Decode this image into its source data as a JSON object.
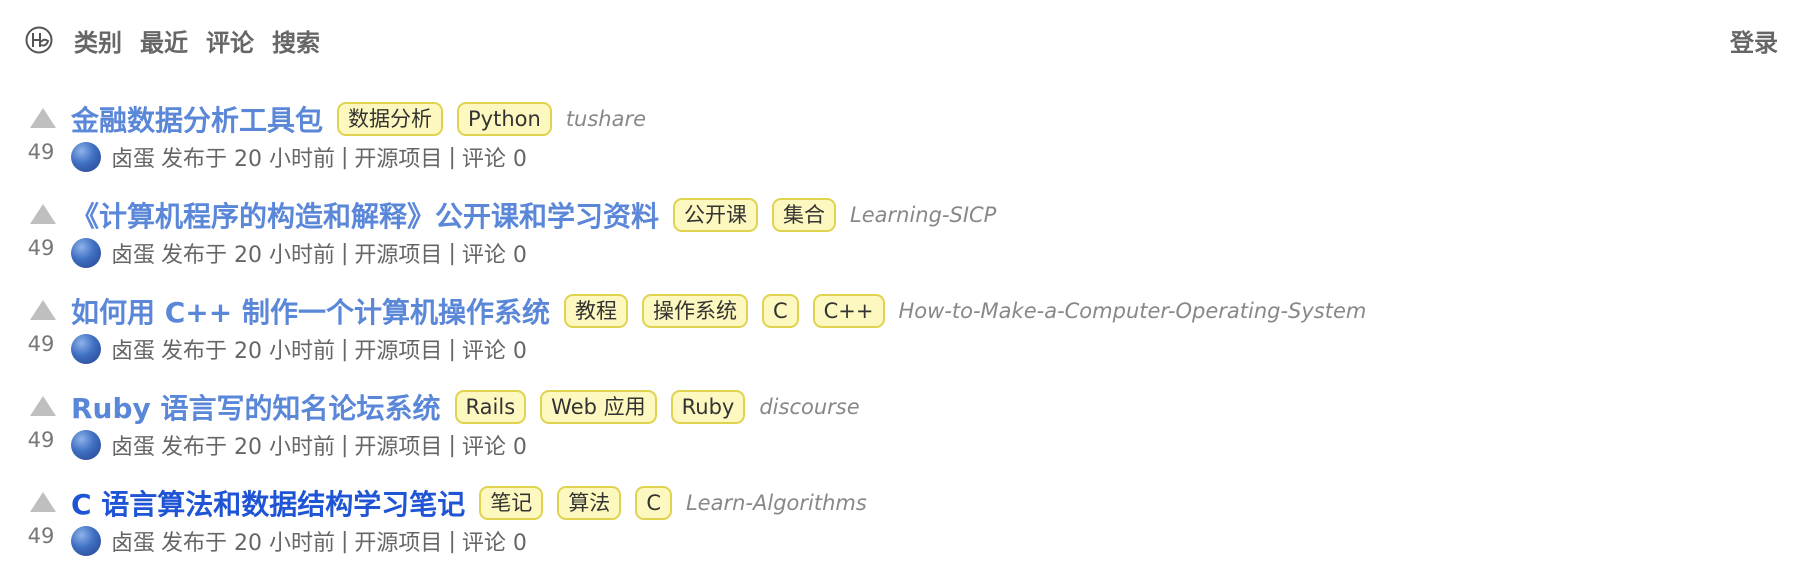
{
  "header": {
    "logo_icon": "logo-icon",
    "nav": [
      "类别",
      "最近",
      "评论",
      "搜索"
    ],
    "login": "登录"
  },
  "items": [
    {
      "votes": "49",
      "title": "金融数据分析工具包",
      "tags": [
        "数据分析",
        "Python"
      ],
      "repo": "tushare",
      "author": "卤蛋",
      "posted": "发布于 20 小时前",
      "category": "开源项目",
      "comments": "评论 0",
      "visited": false
    },
    {
      "votes": "49",
      "title": "《计算机程序的构造和解释》公开课和学习资料",
      "tags": [
        "公开课",
        "集合"
      ],
      "repo": "Learning-SICP",
      "author": "卤蛋",
      "posted": "发布于 20 小时前",
      "category": "开源项目",
      "comments": "评论 0",
      "visited": false
    },
    {
      "votes": "49",
      "title": "如何用 C++ 制作一个计算机操作系统",
      "tags": [
        "教程",
        "操作系统",
        "C",
        "C++"
      ],
      "repo": "How-to-Make-a-Computer-Operating-System",
      "author": "卤蛋",
      "posted": "发布于 20 小时前",
      "category": "开源项目",
      "comments": "评论 0",
      "visited": false
    },
    {
      "votes": "49",
      "title": "Ruby 语言写的知名论坛系统",
      "tags": [
        "Rails",
        "Web 应用",
        "Ruby"
      ],
      "repo": "discourse",
      "author": "卤蛋",
      "posted": "发布于 20 小时前",
      "category": "开源项目",
      "comments": "评论 0",
      "visited": false
    },
    {
      "votes": "49",
      "title": "C 语言算法和数据结构学习笔记",
      "tags": [
        "笔记",
        "算法",
        "C"
      ],
      "repo": "Learn-Algorithms",
      "author": "卤蛋",
      "posted": "发布于 20 小时前",
      "category": "开源项目",
      "comments": "评论 0",
      "visited": true
    }
  ],
  "colors": {
    "link": "#5b87d8",
    "visited_link": "#1f54d4",
    "tag_bg": "#fdf8bf",
    "tag_border": "#e0d350",
    "upvote": "#bfbfbf"
  }
}
